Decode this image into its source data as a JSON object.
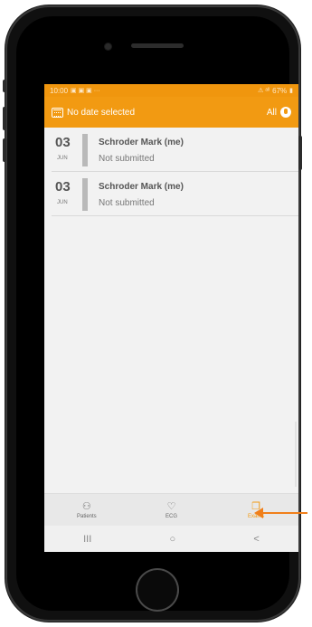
{
  "status_bar": {
    "time": "10:00",
    "left_icons": "▣ ▣ ▣ ···",
    "right_text": "67%",
    "right_icons": "⚠ ᵃˡˡ"
  },
  "app_bar": {
    "title": "No date selected",
    "filter_label": "All"
  },
  "exams": [
    {
      "day": "03",
      "month": "JUN",
      "patient": "Schroder Mark  (me)",
      "status": "Not submitted"
    },
    {
      "day": "03",
      "month": "JUN",
      "patient": "Schroder Mark  (me)",
      "status": "Not submitted"
    }
  ],
  "tabs": [
    {
      "label": "Patients",
      "icon": "patients-icon",
      "glyph": "⚇",
      "active": false
    },
    {
      "label": "ECG",
      "icon": "ecg-heart-icon",
      "glyph": "♡",
      "active": false
    },
    {
      "label": "Exams",
      "icon": "exams-icon",
      "glyph": "❐",
      "active": true
    }
  ],
  "nav_buttons": {
    "recents": "III",
    "home": "○",
    "back": "<"
  },
  "colors": {
    "accent": "#f29a12",
    "annotation_arrow": "#f07f1a"
  }
}
